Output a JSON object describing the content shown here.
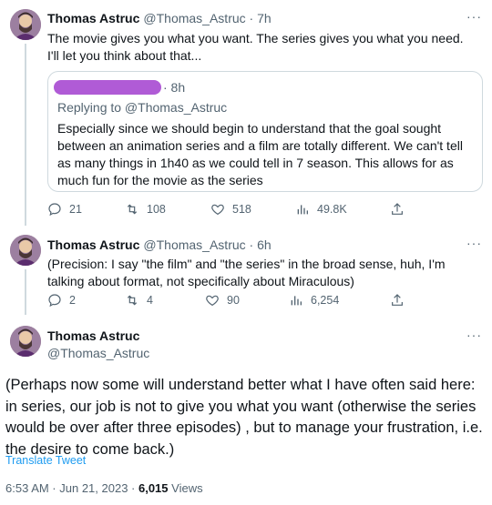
{
  "tweet1": {
    "name": "Thomas Astruc",
    "meta": "@Thomas_Astruc · 7h",
    "more": "···",
    "text": "The movie gives you what you want. The series gives you what you need. I'll let you think about that...",
    "quote": {
      "time": "· 8h",
      "replying": "Replying to @Thomas_Astruc",
      "text": "Especially since we should begin to understand that the goal sought between an animation series and a film are totally different. We can't tell as many things in 1h40 as we could tell in 7 season. This allows for as much fun for the movie as the series"
    },
    "stats": {
      "replies": "21",
      "retweets": "108",
      "likes": "518",
      "views": "49.8K"
    }
  },
  "tweet2": {
    "name": "Thomas Astruc",
    "meta": "@Thomas_Astruc · 6h",
    "more": "···",
    "text": "(Precision: I say \"the film\" and \"the series\" in the broad sense, huh, I'm talking about format, not specifically about Miraculous)",
    "stats": {
      "replies": "2",
      "retweets": "4",
      "likes": "90",
      "views": "6,254"
    }
  },
  "tweet3": {
    "name": "Thomas Astruc",
    "handle": "@Thomas_Astruc",
    "more": "···",
    "text": "(Perhaps now some will understand better what I have often said here: in series, our job is not to give you what you want (otherwise the series would be over after three episodes) , but to manage your frustration, i.e. the desire to come back.)",
    "translate": "Translate Tweet",
    "footer_time": "6:53 AM · Jun 21, 2023 · ",
    "footer_views_count": "6,015",
    "footer_views_label": " Views"
  },
  "colors": {
    "text": "#0f1419",
    "muted": "#536471",
    "link": "#1d9bf0",
    "border": "#cfd9de",
    "redaction": "#b05bd6"
  }
}
